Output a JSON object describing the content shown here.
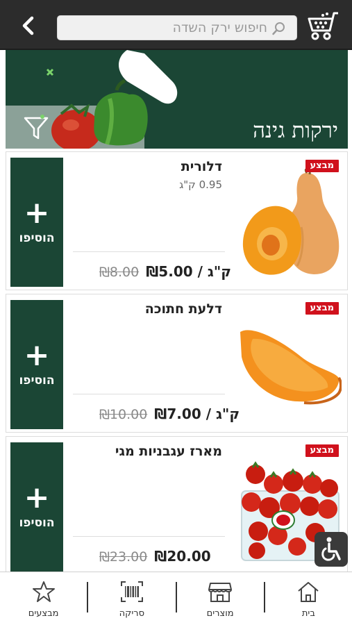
{
  "header": {
    "search_placeholder": "חיפוש ירק השדה"
  },
  "banner": {
    "title": "ירקות גינה"
  },
  "products": [
    {
      "name": "דלורית",
      "weight": "0.95 ק\"ג",
      "badge": "מבצע",
      "price_new": "₪5.00 / ק\"ג",
      "price_old": "₪8.00",
      "add_label": "הוסיפו",
      "add_symbol": "+",
      "image": "butternut-squash-image"
    },
    {
      "name": "דלעת חתוכה",
      "weight": "",
      "badge": "מבצע",
      "price_new": "₪7.00 / ק\"ג",
      "price_old": "₪10.00",
      "add_label": "הוסיפו",
      "add_symbol": "+",
      "image": "cut-pumpkin-image"
    },
    {
      "name": "מארז עגבניות מגי",
      "weight": "",
      "badge": "מבצע",
      "price_new": "₪20.00",
      "price_old": "₪23.00",
      "add_label": "הוסיפו",
      "add_symbol": "+",
      "image": "cherry-tomatoes-pack-image"
    }
  ],
  "bottom_nav": [
    {
      "label": "מבצעים",
      "icon": "star-icon"
    },
    {
      "label": "סריקה",
      "icon": "barcode-icon"
    },
    {
      "label": "מוצרים",
      "icon": "store-icon"
    },
    {
      "label": "בית",
      "icon": "home-icon"
    }
  ],
  "colors": {
    "brand_green": "#1b4635",
    "topbar": "#2c2c2c",
    "sale_red": "#d0111c"
  }
}
